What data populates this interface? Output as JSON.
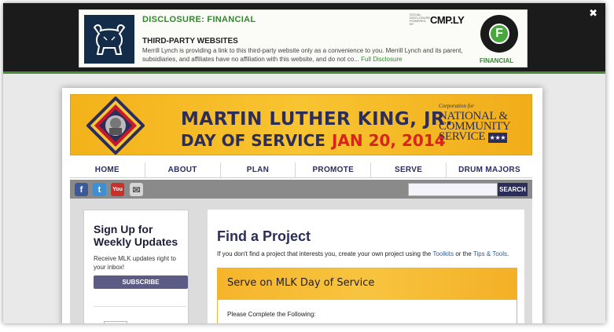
{
  "overlay": {
    "close_label": "✖",
    "disclosure_heading": "DISCLOSURE: FINANCIAL",
    "cmply_small": "Social Disclosure Powered By",
    "cmply_brand": "CMP.LY",
    "subheading": "THIRD-PARTY WEBSITES",
    "body": "Merrill Lynch is providing a link  to this third-party website only as a  convenience to you.  Merrill Lynch and its parent, subsidiaries, and  affiliates have no affiliation with this website, and do not co...",
    "full_link": "Full Disclosure",
    "badge_letter": "F",
    "badge_label": "FINANCIAL",
    "colors": {
      "bar": "#1b1b1b",
      "accent_green": "#2f8a2a",
      "logo_navy": "#132c4a"
    }
  },
  "banner": {
    "title": "MARTIN LUTHER KING, JR.",
    "subtitle": "DAY OF SERVICE",
    "date": "JAN 20, 2014",
    "cncs_small": "Corporation for",
    "cncs_line1": "NATIONAL &",
    "cncs_line2": "COMMUNITY",
    "cncs_line3": "SERVICE",
    "cncs_stars": "★★★",
    "colors": {
      "gold": "#f8c431",
      "navy": "#2b2d5a",
      "red": "#d8231e"
    }
  },
  "nav": {
    "items": [
      "HOME",
      "ABOUT",
      "PLAN",
      "PROMOTE",
      "SERVE",
      "DRUM MAJORS"
    ]
  },
  "social": {
    "icons": [
      "facebook-icon",
      "twitter-icon",
      "youtube-icon",
      "mail-icon"
    ],
    "fb": "f",
    "tw": "t",
    "yt": "You",
    "mail": "✉"
  },
  "search": {
    "placeholder": "",
    "button_label": "SEARCH"
  },
  "sidebar": {
    "title": "Sign Up for Weekly Updates",
    "text": "Receive MLK updates right to your inbox!",
    "button_label": "SUBSCRIBE"
  },
  "main": {
    "title": "Find a Project",
    "text_prefix": "If you don't find a project that interests you, create your own project using the ",
    "link_toolkits": "Toolkits",
    "text_mid": " or the ",
    "link_tips": "Tips & Tools",
    "text_suffix": ".",
    "box_heading": "Serve on MLK Day of Service",
    "box_text": "Please Complete the Following:"
  }
}
